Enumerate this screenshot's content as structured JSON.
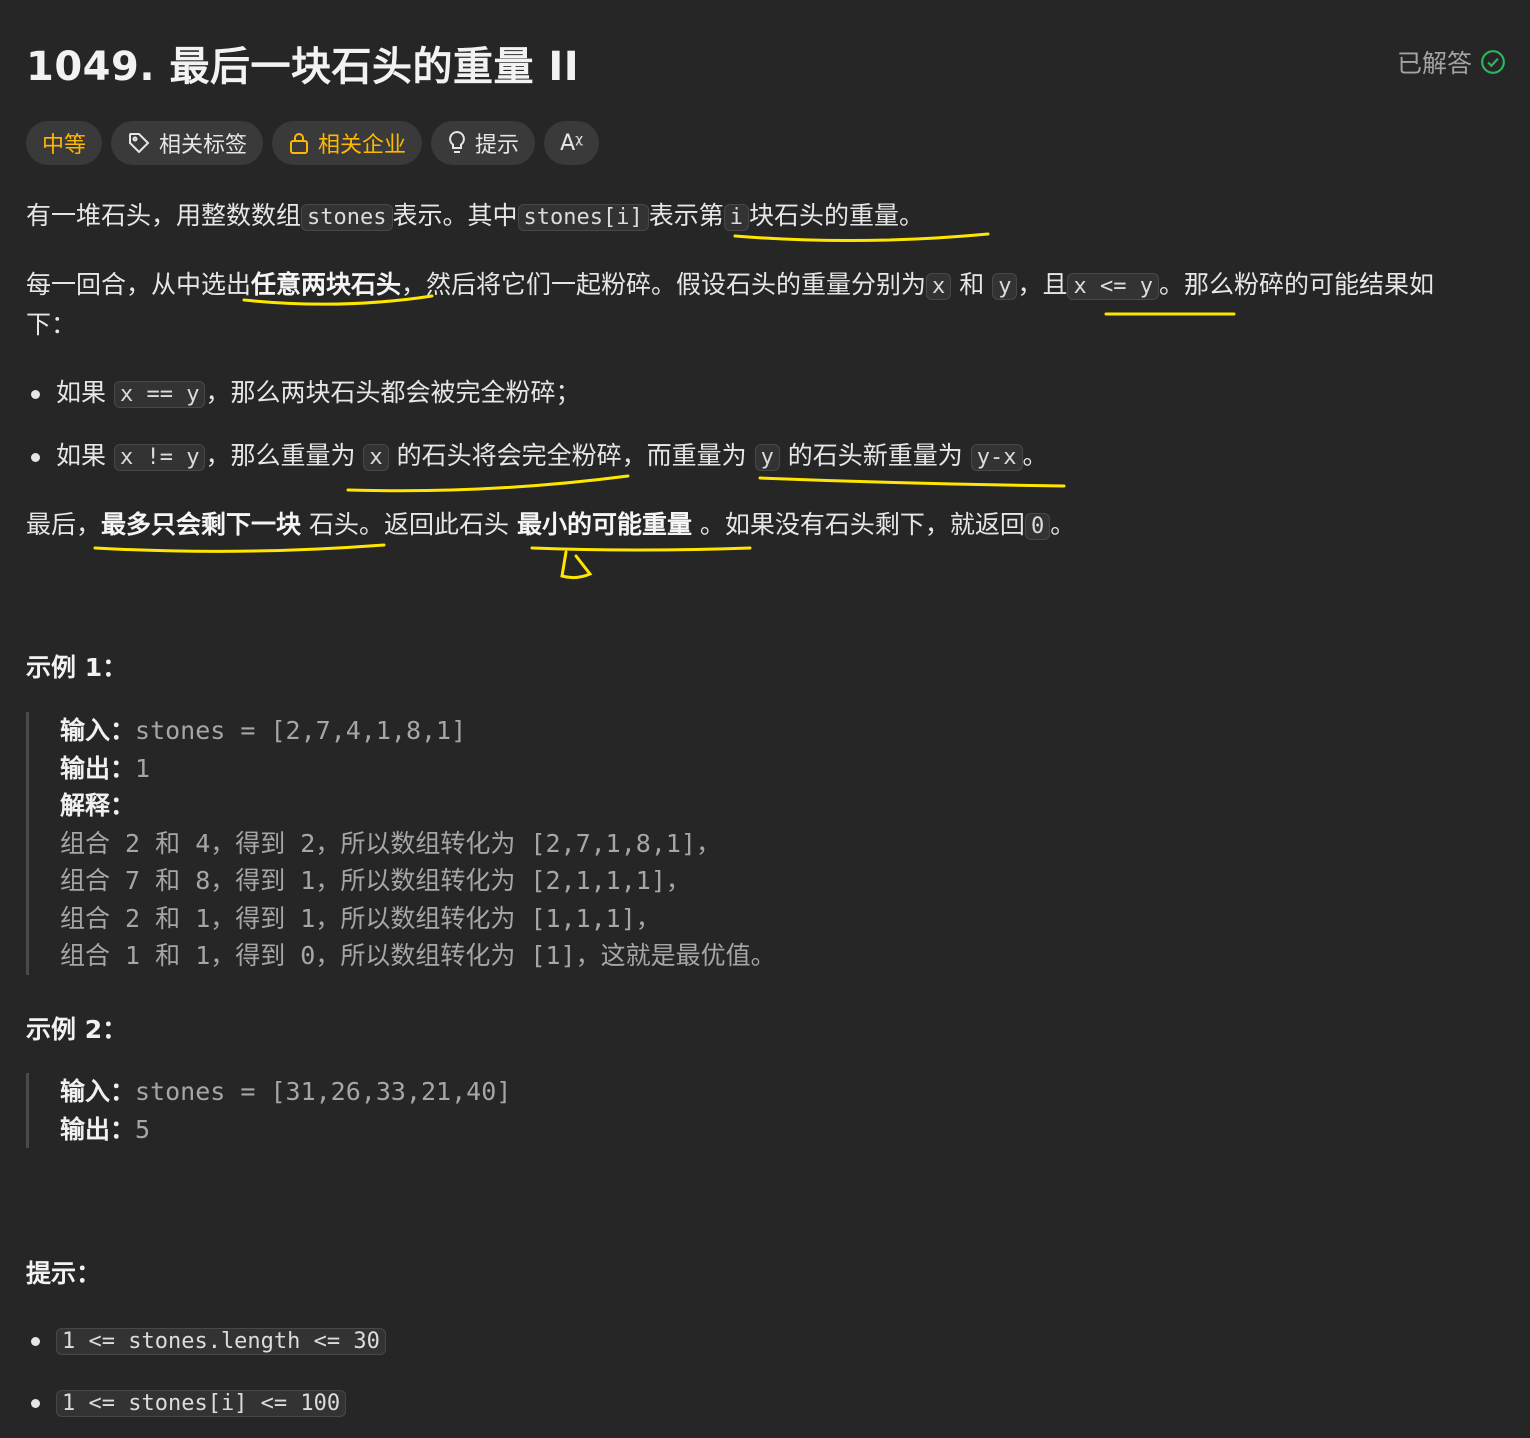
{
  "problem": {
    "number": "1049.",
    "title": "最后一块石头的重量 II",
    "status": "已解答"
  },
  "chips": {
    "difficulty": "中等",
    "tags": "相关标签",
    "companies": "相关企业",
    "hints": "提示",
    "translate_icon": "Aᵡ"
  },
  "desc": {
    "p1": {
      "t1": "有一堆石头，用整数数组",
      "c1": "stones",
      "t2": "表示。其中",
      "c2": "stones[i]",
      "t3": "表示第",
      "c3": "i",
      "t4": "块石头的重量。"
    },
    "p2": {
      "t1": "每一回合，从中选出",
      "b1": "任意两块石头",
      "t2": "，然后将它们一起粉碎。假设石头的重量分别为",
      "c1": "x",
      "t3": "和",
      "c2": "y",
      "t4": "，且",
      "c3": "x <= y",
      "t5": "。那么粉碎的可能结果如",
      "t6": "下："
    },
    "bullet1": {
      "t1": "如果",
      "c1": "x == y",
      "t2": "，那么两块石头都会被完全粉碎；"
    },
    "bullet2": {
      "t1": "如果",
      "c1": "x != y",
      "t2": "，那么重量为",
      "c2": "x",
      "t3": "的石头将会完全粉碎，而重量为",
      "c3": "y",
      "t4": "的石头新重量为",
      "c4": "y-x",
      "t5": "。"
    },
    "p3": {
      "t1": "最后，",
      "b1": "最多只会剩下一块",
      "t2": "石头。返回此石头",
      "b2": "最小的可能重量",
      "t3": "。如果没有石头剩下，就返回",
      "c1": "0",
      "t4": "。"
    }
  },
  "example1": {
    "heading": "示例 1：",
    "input_label": "输入：",
    "input": "stones = [2,7,4,1,8,1]",
    "output_label": "输出：",
    "output": "1",
    "explain_label": "解释：",
    "lines": [
      "组合 2 和 4，得到 2，所以数组转化为 [2,7,1,8,1]，",
      "组合 7 和 8，得到 1，所以数组转化为 [2,1,1,1]，",
      "组合 2 和 1，得到 1，所以数组转化为 [1,1,1]，",
      "组合 1 和 1，得到 0，所以数组转化为 [1]，这就是最优值。"
    ]
  },
  "example2": {
    "heading": "示例 2：",
    "input_label": "输入：",
    "input": "stones = [31,26,33,21,40]",
    "output_label": "输出：",
    "output": "5"
  },
  "constraints": {
    "heading": "提示：",
    "items": [
      "1 <= stones.length <= 30",
      "1 <= stones[i] <= 100"
    ]
  },
  "colors": {
    "background": "#262626",
    "accent": "#ffb800",
    "solved": "#2db55d",
    "annotation": "#ffe600"
  }
}
